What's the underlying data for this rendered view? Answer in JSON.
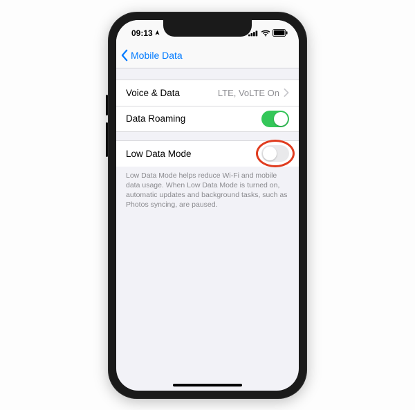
{
  "statusbar": {
    "time": "09:13"
  },
  "nav": {
    "back_label": "Mobile Data"
  },
  "group1": {
    "voice_data": {
      "label": "Voice & Data",
      "value": "LTE, VoLTE On"
    },
    "data_roaming": {
      "label": "Data Roaming",
      "on": true
    }
  },
  "group2": {
    "low_data_mode": {
      "label": "Low Data Mode",
      "on": false
    },
    "footer": "Low Data Mode helps reduce Wi-Fi and mobile data usage. When Low Data Mode is turned on, automatic updates and background tasks, such as Photos syncing, are paused."
  }
}
